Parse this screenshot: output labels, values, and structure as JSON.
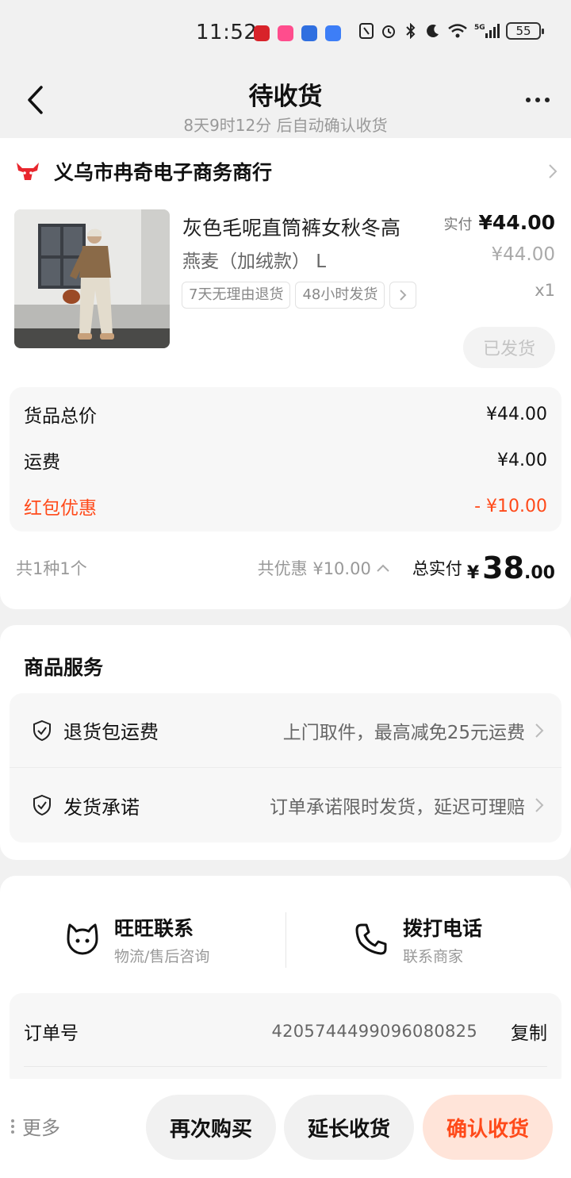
{
  "status_bar": {
    "time": "11:52",
    "network": "5G",
    "battery": "55"
  },
  "header": {
    "title": "待收货",
    "subtitle": "8天9时12分 后自动确认收货"
  },
  "shop": {
    "name": "义乌市冉奇电子商务商行"
  },
  "product": {
    "title": "灰色毛呢直筒裤女秋冬高",
    "sku": "燕麦（加绒款） L",
    "tags": [
      "7天无理由退货",
      "48小时发货"
    ],
    "price_label": "实付",
    "price": "¥44.00",
    "orig_price": "¥44.00",
    "quantity": "x1",
    "status_button": "已发货"
  },
  "fees": {
    "goods_label": "货品总价",
    "goods_value": "¥44.00",
    "shipping_label": "运费",
    "shipping_value": "¥4.00",
    "coupon_label": "红包优惠",
    "coupon_value": "- ¥10.00"
  },
  "summary": {
    "count": "共1种1个",
    "discount": "共优惠 ¥10.00",
    "total_label": "总实付",
    "currency": "¥",
    "total_int": "38",
    "total_dec": ".00"
  },
  "services": {
    "title": "商品服务",
    "items": [
      {
        "name": "退货包运费",
        "desc": "上门取件，最高减免25元运费"
      },
      {
        "name": "发货承诺",
        "desc": "订单承诺限时发货，延迟可理赔"
      }
    ]
  },
  "contact": {
    "wangwang_title": "旺旺联系",
    "wangwang_sub": "物流/售后咨询",
    "phone_title": "拨打电话",
    "phone_sub": "联系商家"
  },
  "order": {
    "label": "订单号",
    "number": "4205744499096080825",
    "copy": "复制"
  },
  "bottom": {
    "more": "更多",
    "buy_again": "再次购买",
    "extend": "延长收货",
    "confirm": "确认收货"
  },
  "colors": {
    "accent": "#ff4a1a",
    "confirm_bg": "#ffe4d9",
    "shop_logo": "#e8262d"
  }
}
